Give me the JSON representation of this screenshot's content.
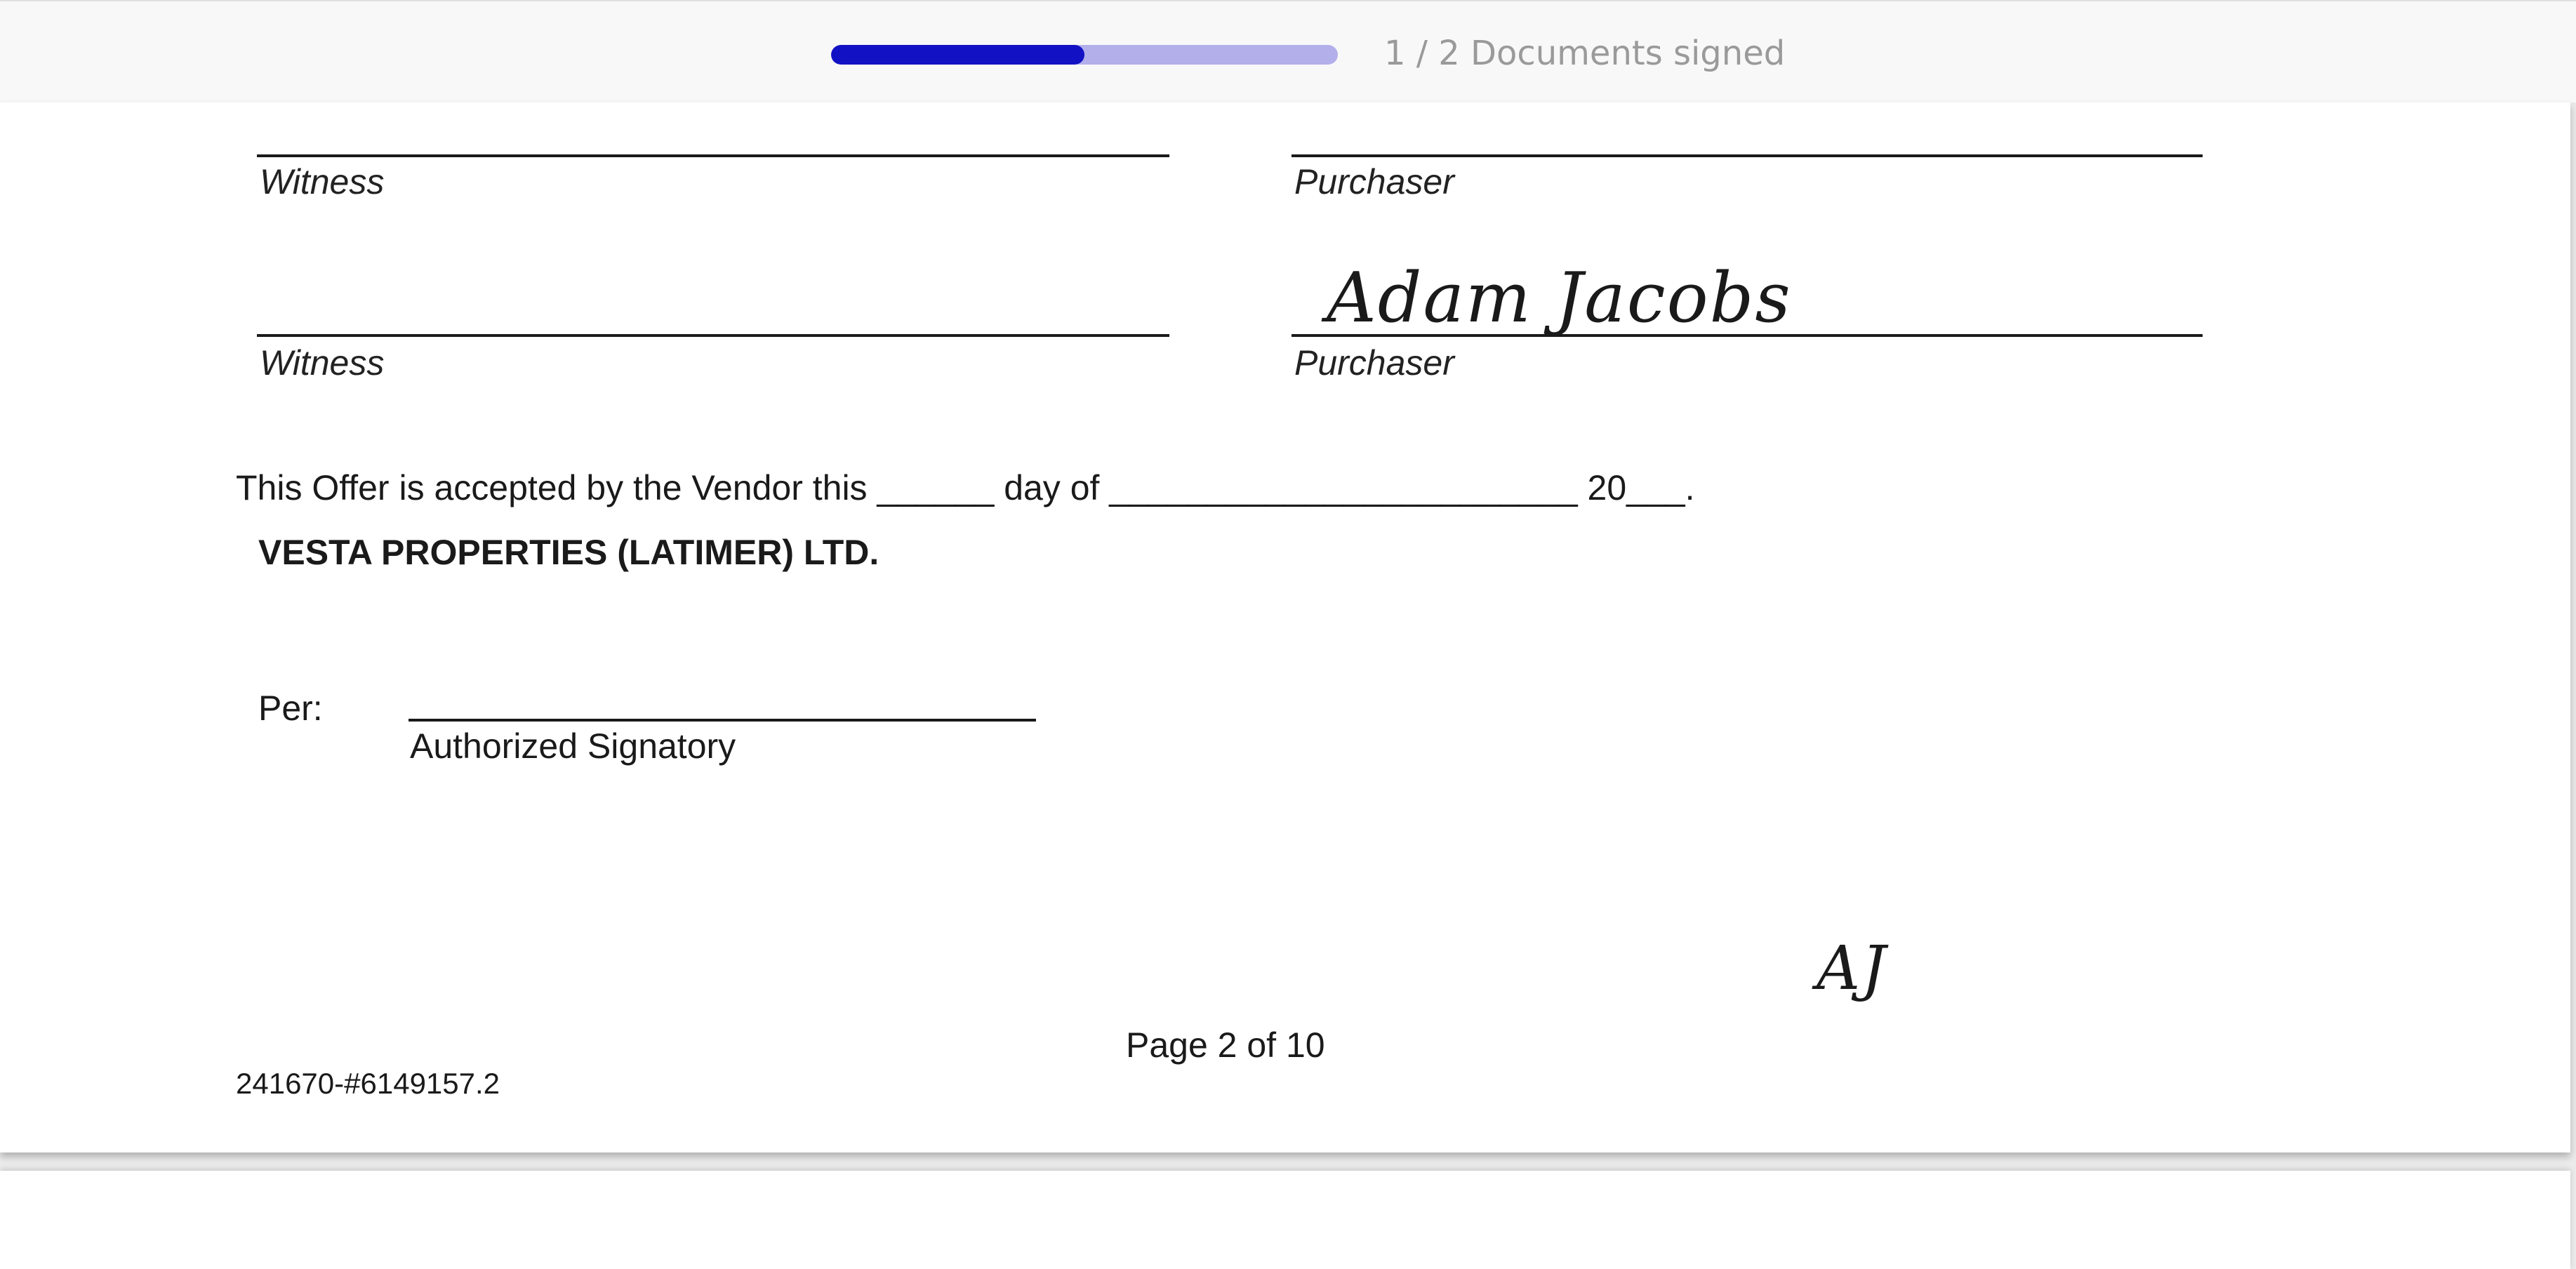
{
  "progress": {
    "label": "1 / 2 Documents signed",
    "fraction": 0.5
  },
  "document": {
    "witness_label_1": "Witness",
    "purchaser_label_1": "Purchaser",
    "witness_label_2": "Witness",
    "purchaser_label_2": "Purchaser",
    "purchaser_signature": "Adam Jacobs",
    "acceptance_text": "This Offer is accepted by the Vendor this ______ day of ________________________ 20___.",
    "vendor_name": "VESTA PROPERTIES (LATIMER) LTD.",
    "per_label": "Per:",
    "authorized_signatory_label": "Authorized Signatory",
    "initials": "AJ",
    "page_number": "Page 2 of 10",
    "doc_reference": "241670-#6149157.2"
  }
}
